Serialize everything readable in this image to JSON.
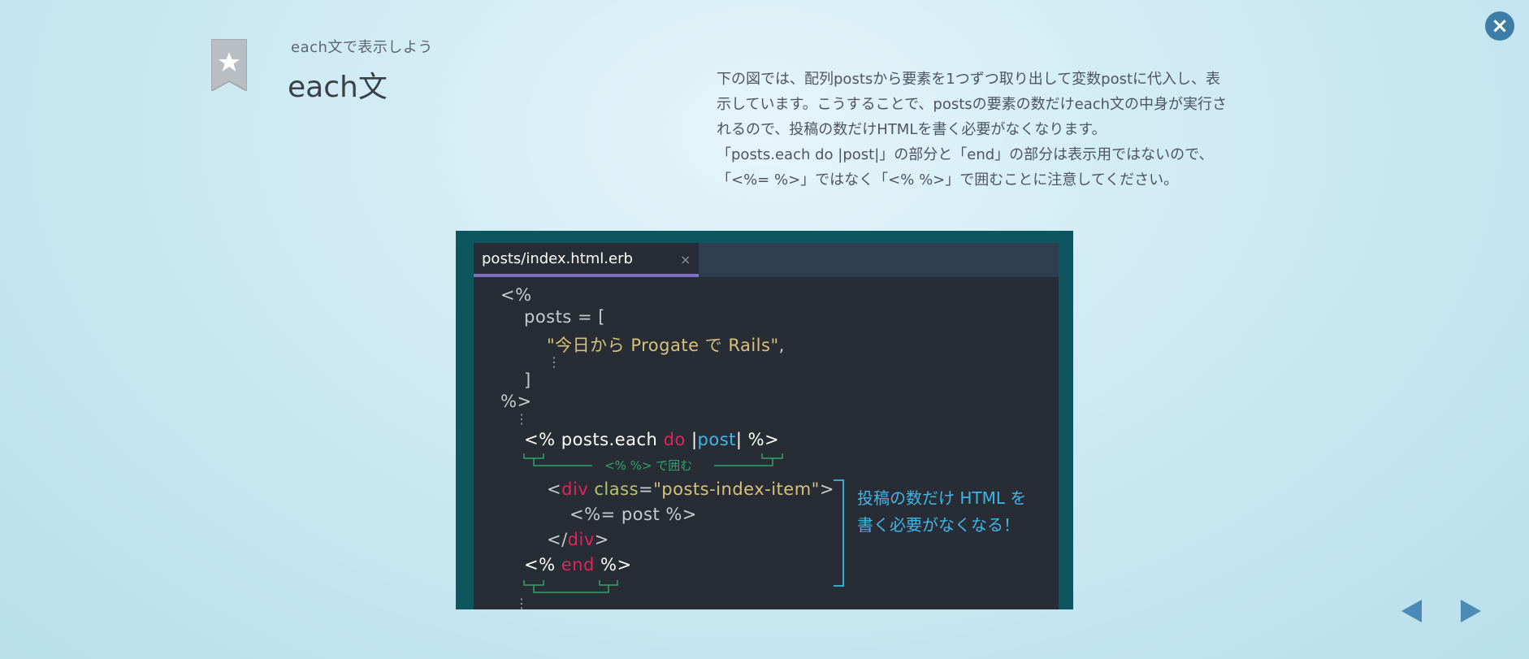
{
  "header": {
    "subtitle": "each文で表示しよう",
    "title": "each文"
  },
  "description": {
    "lines": [
      "下の図では、配列postsから要素を1つずつ取り出して変数postに代入し、表",
      "示しています。こうすることで、postsの要素の数だけeach文の中身が実行さ",
      "れるので、投稿の数だけHTMLを書く必要がなくなります。",
      "「posts.each do |post|」の部分と「end」の部分は表示用ではないので、",
      "「<%= %>」ではなく「<% %>」で囲むことに注意してください。"
    ]
  },
  "editor": {
    "tab_label": "posts/index.html.erb",
    "tab_close": "×",
    "code": {
      "open_tag": "<%",
      "posts_assign": "posts = [",
      "string_item": "\"今日から Progate で Rails\"",
      "comma": ",",
      "ellipsis": "⋮",
      "close_bracket": "]",
      "close_tag": "%>",
      "each_open": "<%",
      "each_expr": "posts.each",
      "each_do": "do",
      "pipe_open": "|",
      "each_var": "post",
      "pipe_close": "|",
      "each_close": "%>",
      "div_lt": "<",
      "div_name": "div",
      "div_attr": "class",
      "div_eq": "=",
      "div_value": "\"posts-index-item\"",
      "div_gt": ">",
      "post_output": "<%= post %>",
      "div_close_lt": "</",
      "div_close_name": "div",
      "div_close_gt": ">",
      "end_open": "<%",
      "end_kw": "end",
      "end_close": "%>"
    },
    "annotations": {
      "wrap_label": "<% %> で囲む",
      "html_note_line1": "投稿の数だけ HTML を",
      "html_note_line2": "書く必要がなくなる！"
    }
  },
  "icons": {
    "close": "close-icon",
    "bookmark": "bookmark-star-icon",
    "prev": "prev-arrow-icon",
    "next": "next-arrow-icon"
  },
  "colors": {
    "accent_blue": "#3d7da6",
    "editor_bg": "#282c34",
    "frame_teal": "#0d5660",
    "tab_underline": "#7d6fc2",
    "keyword_red": "#e0245e",
    "variable_blue": "#3fb6e8",
    "string_yellow": "#d6c27a",
    "annotation_green": "#2ea56a"
  }
}
